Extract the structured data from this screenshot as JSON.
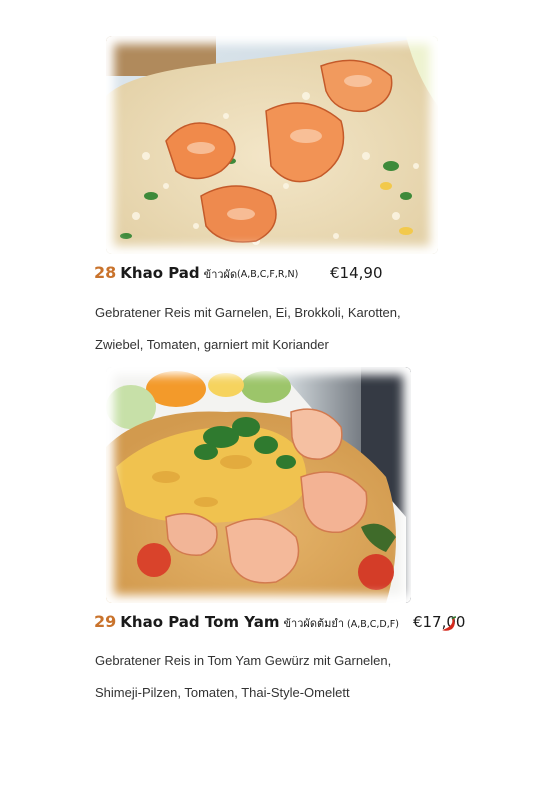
{
  "dishes": [
    {
      "number": "28",
      "name": "Khao Pad",
      "thai_name": "ข้าวผัด",
      "allergens": "(A,B,C,F,R,N)",
      "price": "€14,90",
      "description_lines": [
        "Gebratener Reis mit Garnelen, Ei, Brokkoli, Karotten,",
        "Zwiebel, Tomaten, garniert mit Koriander"
      ],
      "photo": "fried-rice-with-shrimp-photo",
      "spicy": false
    },
    {
      "number": "29",
      "name": "Khao Pad Tom Yam",
      "thai_name": "ข้าวผัดต้มยำ",
      "allergens": "(A,B,C,D,F)",
      "price": "€17,00",
      "description_lines": [
        "Gebratener Reis in Tom Yam Gewürz mit Garnelen,",
        "Shimeji-Pilzen, Tomaten, Thai-Style-Omelett"
      ],
      "photo": "tom-yam-fried-rice-photo",
      "spicy": true,
      "spicy_icon": "chili-icon"
    }
  ],
  "colors": {
    "number": "#c9732c",
    "chili": "#d42a1e"
  }
}
